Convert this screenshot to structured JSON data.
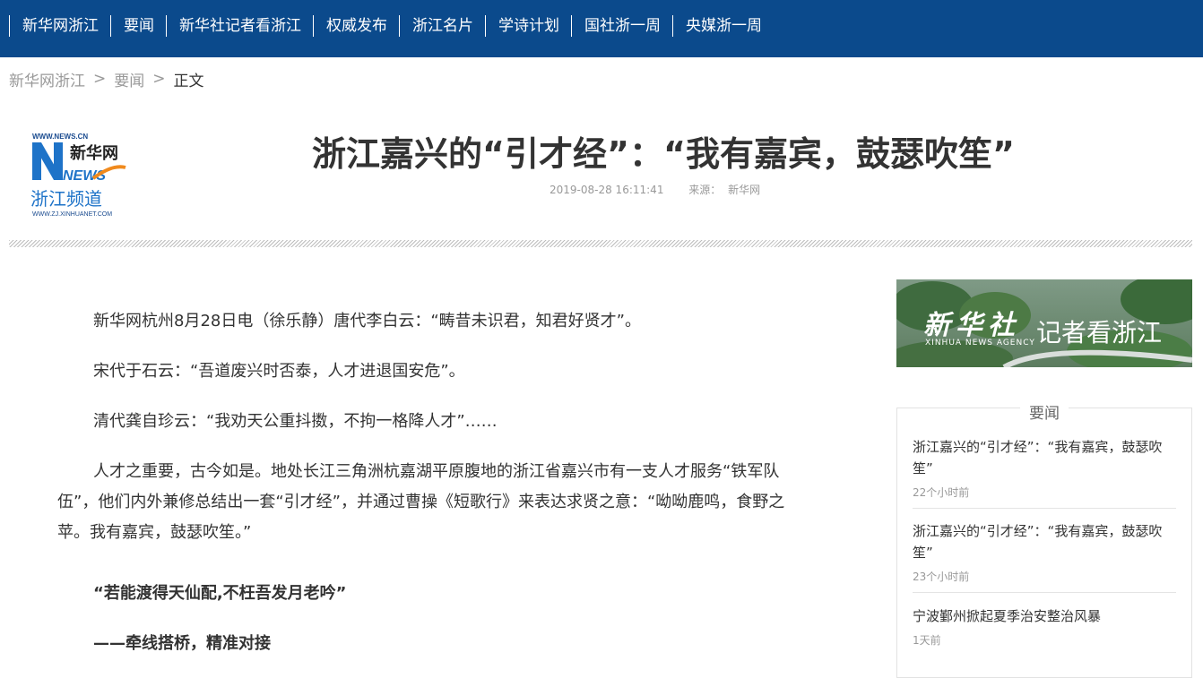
{
  "nav": {
    "items": [
      "新华网浙江",
      "要闻",
      "新华社记者看浙江",
      "权威发布",
      "浙江名片",
      "学诗计划",
      "国社浙一周",
      "央媒浙一周"
    ]
  },
  "breadcrumb": {
    "home": "新华网浙江",
    "section": "要闻",
    "current": "正文",
    "separator": ">"
  },
  "logo": {
    "site": "WWW.NEWS.CN",
    "brand": "新华网",
    "news": "NEWS",
    "channel": "浙江频道",
    "url": "WWW.ZJ.XINHUANET.COM"
  },
  "article": {
    "title": "浙江嘉兴的“引才经”：“我有嘉宾，鼓瑟吹笙”",
    "datetime": "2019-08-28 16:11:41",
    "source_label": "来源：",
    "source": "新华网",
    "paragraphs": [
      "新华网杭州8月28日电（徐乐静）唐代李白云：“畴昔未识君，知君好贤才”。",
      "宋代于石云：“吾道废兴时否泰，人才进退国安危”。",
      "清代龚自珍云：“我劝天公重抖擞，不拘一格降人才”……",
      "人才之重要，古今如是。地处长江三角洲杭嘉湖平原腹地的浙江省嘉兴市有一支人才服务“铁军队伍”，他们内外兼修总结出一套“引才经”，并通过曹操《短歌行》来表达求贤之意：“呦呦鹿鸣，食野之苹。我有嘉宾，鼓瑟吹笙。”",
      "“若能渡得天仙配,不枉吾发月老吟”",
      "——牵线搭桥，精准对接"
    ]
  },
  "sidebar": {
    "banner": {
      "brush": "新华社",
      "sub": "XINHUA NEWS AGENCY",
      "text": "记者看浙江"
    },
    "news_header": "要闻",
    "news": [
      {
        "title": "浙江嘉兴的“引才经”：“我有嘉宾，鼓瑟吹笙”",
        "time": "22个小时前"
      },
      {
        "title": "浙江嘉兴的“引才经”：“我有嘉宾，鼓瑟吹笙”",
        "time": "23个小时前"
      },
      {
        "title": "宁波鄞州掀起夏季治安整治风暴",
        "time": "1天前"
      }
    ]
  },
  "colors": {
    "topbar": "#0b4a8c",
    "text": "#333333",
    "meta": "#999999"
  }
}
